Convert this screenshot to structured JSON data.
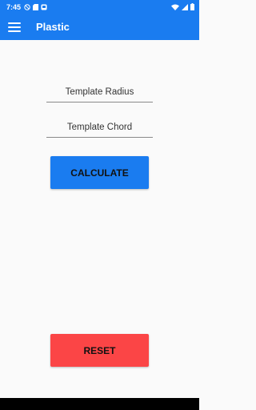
{
  "status_bar": {
    "time": "7:45",
    "left_icons": [
      "dnd-icon",
      "sd-card-icon",
      "shield-icon"
    ],
    "right_icons": [
      "wifi-icon",
      "signal-icon",
      "battery-icon"
    ]
  },
  "app_bar": {
    "title": "Plastic",
    "menu_icon": "hamburger-menu-icon"
  },
  "form": {
    "radius_placeholder": "Template Radius",
    "chord_placeholder": "Template Chord"
  },
  "buttons": {
    "calculate_label": "CALCULATE",
    "reset_label": "RESET"
  },
  "colors": {
    "primary": "#1a7cf0",
    "reset": "#fb4546"
  }
}
